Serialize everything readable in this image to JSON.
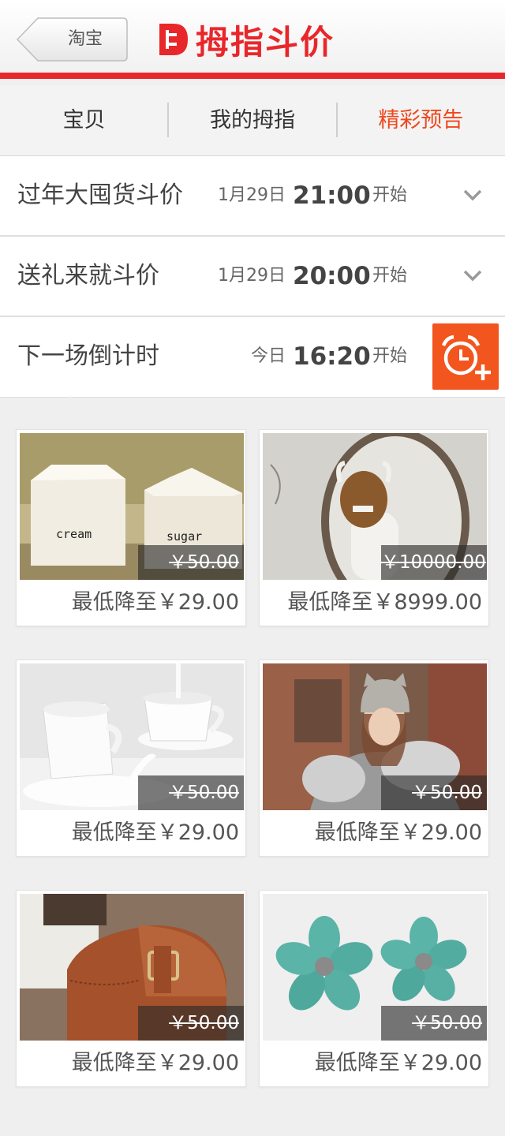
{
  "header": {
    "back_label": "淘宝",
    "logo_text": "拇指斗价",
    "accent": "#e8272b"
  },
  "tabs": [
    {
      "label": "宝贝",
      "active": false
    },
    {
      "label": "我的拇指",
      "active": false
    },
    {
      "label": "精彩预告",
      "active": true
    }
  ],
  "schedule": [
    {
      "title": "过年大囤货斗价",
      "date": "1月29日",
      "time": "21:00",
      "suffix": "开始",
      "icon": "chevron-down-icon"
    },
    {
      "title": "送礼来就斗价",
      "date": "1月29日",
      "time": "20:00",
      "suffix": "开始",
      "icon": "chevron-down-icon"
    }
  ],
  "countdown": {
    "title": "下一场倒计时",
    "date": "今日",
    "time": "16:20",
    "suffix": "开始",
    "icon": "alarm-add-icon",
    "button_color": "#f2551d"
  },
  "products": [
    {
      "name": "cream-sugar-jars",
      "original_price": "￥50.00",
      "lowest": "最低降至￥29.00",
      "jar_labels": [
        "cream",
        "sugar"
      ]
    },
    {
      "name": "monster-figure",
      "original_price": "￥10000.00",
      "lowest": "最低降至￥8999.00"
    },
    {
      "name": "white-cups",
      "original_price": "￥50.00",
      "lowest": "最低降至￥29.00"
    },
    {
      "name": "knit-hat-girl",
      "original_price": "￥50.00",
      "lowest": "最低降至￥29.00"
    },
    {
      "name": "leather-bag",
      "original_price": "￥50.00",
      "lowest": "最低降至￥29.00"
    },
    {
      "name": "flower-earrings",
      "original_price": "￥50.00",
      "lowest": "最低降至￥29.00"
    }
  ]
}
